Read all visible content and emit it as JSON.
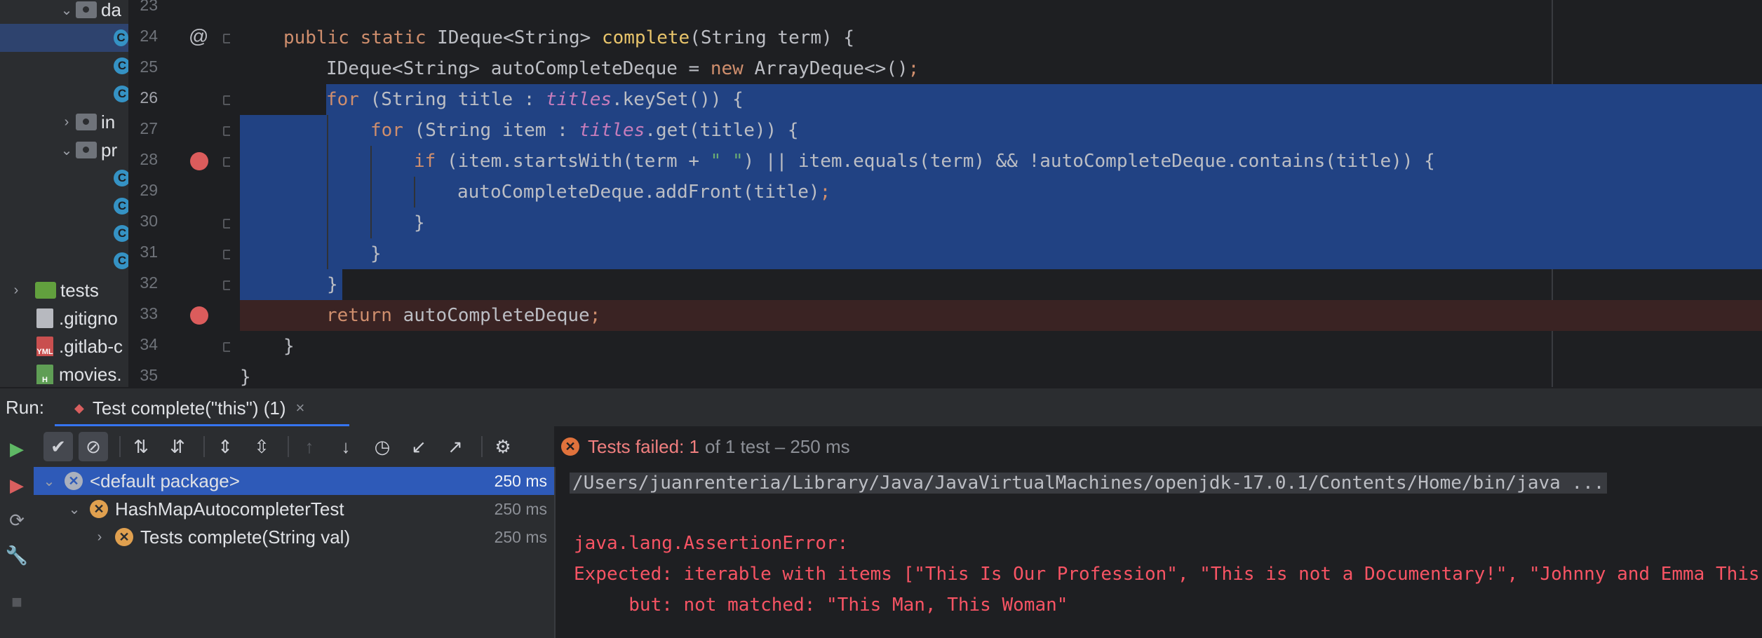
{
  "project_tree": {
    "items": [
      {
        "label": "da",
        "type": "package-folder",
        "expanded": true
      },
      {
        "label": "C",
        "type": "class",
        "selected": true
      },
      {
        "label": "C",
        "type": "class"
      },
      {
        "label": "C",
        "type": "class"
      },
      {
        "label": "in",
        "type": "package-folder",
        "expanded": false
      },
      {
        "label": "pr",
        "type": "package-folder",
        "expanded": true
      },
      {
        "label": "C",
        "type": "class"
      },
      {
        "label": "C",
        "type": "class"
      },
      {
        "label": "C",
        "type": "class"
      },
      {
        "label": "C",
        "type": "class"
      },
      {
        "label": "tests",
        "type": "test-folder",
        "expanded": false
      },
      {
        "label": ".gitigno",
        "type": "file"
      },
      {
        "label": ".gitlab-c",
        "type": "yml-file",
        "icon_text": "YML"
      },
      {
        "label": "movies.",
        "type": "movie-file",
        "icon_text": "H"
      }
    ]
  },
  "editor": {
    "line_numbers": [
      "23",
      "24",
      "25",
      "26",
      "27",
      "28",
      "29",
      "30",
      "31",
      "32",
      "33",
      "34",
      "35"
    ],
    "current_line": "26",
    "breakpoint_lines": [
      "28",
      "33"
    ],
    "override_marker": "@",
    "code": {
      "l24": {
        "kw1": "public",
        "kw2": "static",
        "type1": "IDeque<String>",
        "method": "complete",
        "rest": "(String term) {"
      },
      "l25": {
        "a": "IDeque<String> autoCompleteDeque = ",
        "kw": "new",
        "b": " ArrayDeque<>()",
        "semi": ";"
      },
      "l26": {
        "kw": "for",
        "a": " (String title : ",
        "fld": "titles",
        "b": ".keySet()) {"
      },
      "l27": {
        "kw": "for",
        "a": " (String item : ",
        "fld": "titles",
        "b": ".get(title)) {"
      },
      "l28": {
        "kw": "if",
        "a": " (item.startsWith(term + ",
        "str": "\" \"",
        "b": ") || item.equals(term) && !autoCompleteDeque.contains(title)) {"
      },
      "l29": {
        "a": "autoCompleteDeque.addFront(title)",
        "semi": ";"
      },
      "l30": {
        "a": "}"
      },
      "l31": {
        "a": "}"
      },
      "l32": {
        "a": "}"
      },
      "l33": {
        "kw": "return",
        "a": " autoCompleteDeque",
        "semi": ";"
      },
      "l34": {
        "a": "}"
      },
      "l35": {
        "a": "}"
      }
    }
  },
  "run_panel": {
    "label": "Run:",
    "tab_label": "Test complete(\"this\") (1)",
    "close_glyph": "×",
    "status": {
      "prefix": "Tests failed: 1",
      "suffix": "of 1 test – 250 ms"
    },
    "tree": [
      {
        "label": "<default package>",
        "time": "250 ms",
        "selected": true
      },
      {
        "label": "HashMapAutocompleterTest",
        "time": "250 ms"
      },
      {
        "label": "Tests complete(String val)",
        "time": "250 ms"
      }
    ],
    "console": {
      "command": "/Users/juanrenteria/Library/Java/JavaVirtualMachines/openjdk-17.0.1/Contents/Home/bin/java ...",
      "error_type": "java.lang.AssertionError:",
      "expected": "Expected: iterable with items [\"This Is Our Profession\", \"This is not a Documentary!\", \"Johnny and Emma This",
      "but": "     but: not matched: \"This Man, This Woman\""
    }
  },
  "colors": {
    "selection": "#214283",
    "keyword": "#cf8e6d",
    "method_decl": "#e8c46b",
    "field": "#c77dbb",
    "string": "#6aab73",
    "breakpoint": "#db5c5c",
    "error_text": "#f75464",
    "tree_selection": "#2e5ab8"
  }
}
